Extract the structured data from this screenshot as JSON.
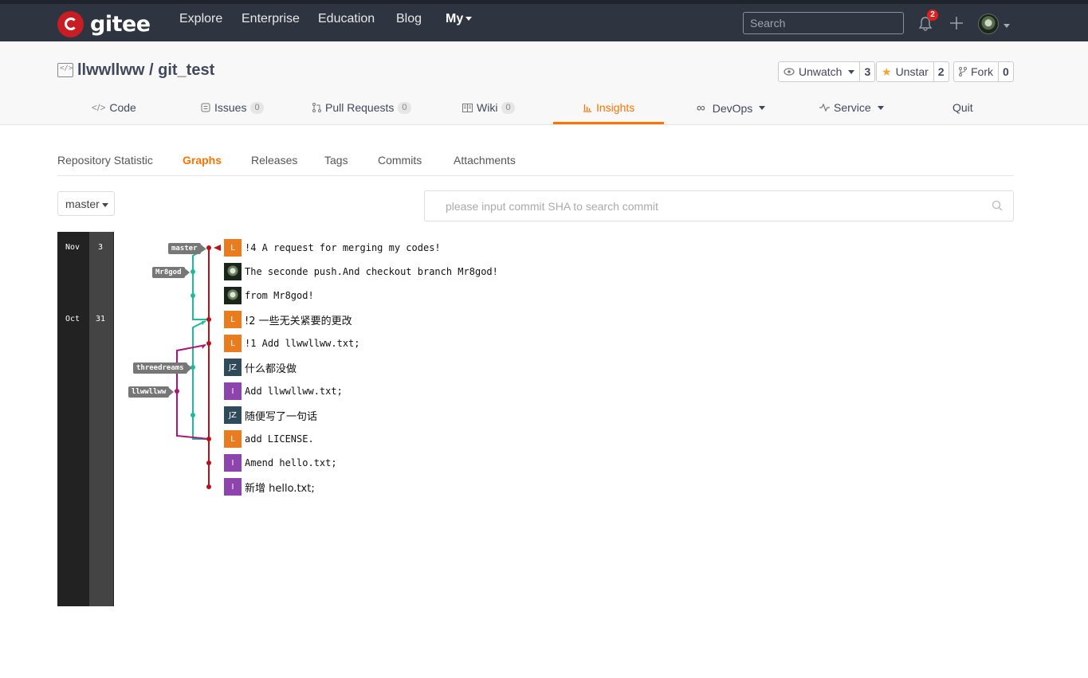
{
  "nav": {
    "logo_text": "gitee",
    "links": [
      "Explore",
      "Enterprise",
      "Education",
      "Blog"
    ],
    "my_label": "My",
    "search_placeholder": "Search",
    "notification_count": "2"
  },
  "repo": {
    "title": "llwwllww / git_test",
    "watch": {
      "label": "Unwatch",
      "count": "3"
    },
    "star": {
      "label": "Unstar",
      "count": "2"
    },
    "fork": {
      "label": "Fork",
      "count": "0"
    }
  },
  "tabs": [
    {
      "label": "Code"
    },
    {
      "label": "Issues",
      "count": "0"
    },
    {
      "label": "Pull Requests",
      "count": "0"
    },
    {
      "label": "Wiki",
      "count": "0"
    },
    {
      "label": "Insights"
    },
    {
      "label": "DevOps"
    },
    {
      "label": "Service"
    },
    {
      "label": "Quit"
    }
  ],
  "subtabs": [
    "Repository Statistic",
    "Graphs",
    "Releases",
    "Tags",
    "Commits",
    "Attachments"
  ],
  "branch_select": "master",
  "commit_search_placeholder": "please input commit SHA to search commit",
  "timeline": [
    {
      "month": "Nov",
      "day": "3"
    },
    {
      "month": "Oct",
      "day": "31"
    }
  ],
  "branch_labels": [
    "master",
    "Mr8god",
    "threedreams",
    "llwwllww"
  ],
  "commits": [
    {
      "avatar": "L",
      "avatar_color": "#e87c1e",
      "message": "!4 A request for merging my codes!"
    },
    {
      "avatar": "",
      "avatar_color": "#1a2418",
      "message": "The seconde push.And checkout branch Mr8god!"
    },
    {
      "avatar": "",
      "avatar_color": "#1a2418",
      "message": "from Mr8god!"
    },
    {
      "avatar": "L",
      "avatar_color": "#e87c1e",
      "message": "!2 一些无关紧要的更改"
    },
    {
      "avatar": "L",
      "avatar_color": "#e87c1e",
      "message": "!1 Add llwwllww.txt;"
    },
    {
      "avatar": "JZ",
      "avatar_color": "#2f4a5a",
      "message": "什么都没做"
    },
    {
      "avatar": "I",
      "avatar_color": "#8e44ad",
      "message": "Add llwwllww.txt;"
    },
    {
      "avatar": "JZ",
      "avatar_color": "#2f4a5a",
      "message": "随便写了一句话"
    },
    {
      "avatar": "L",
      "avatar_color": "#e87c1e",
      "message": "add LICENSE."
    },
    {
      "avatar": "I",
      "avatar_color": "#8e44ad",
      "message": "Amend hello.txt;"
    },
    {
      "avatar": "I",
      "avatar_color": "#8e44ad",
      "message": "新增 hello.txt;"
    }
  ],
  "colors": {
    "accent": "#fe7300",
    "master_line": "#b8131d",
    "teal_line": "#1abc9c",
    "purple_line": "#b0127a"
  }
}
